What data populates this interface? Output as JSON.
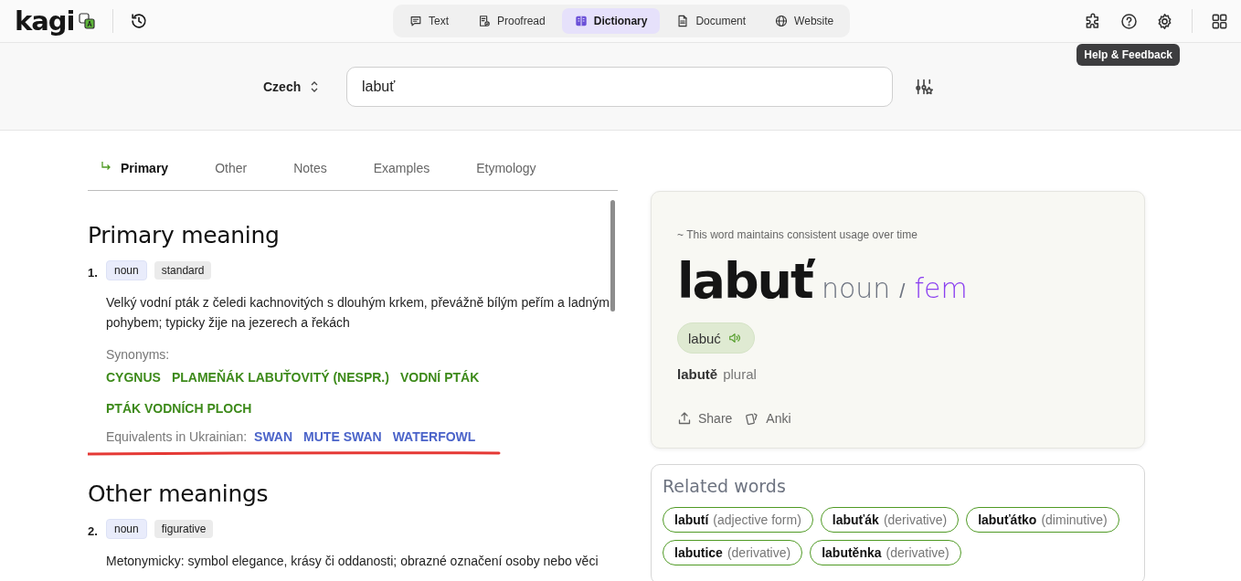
{
  "header": {
    "logo": "kagi",
    "modes": [
      {
        "label": "Text",
        "kind": "chat",
        "selected": false
      },
      {
        "label": "Proofread",
        "kind": "proof",
        "selected": false
      },
      {
        "label": "Dictionary",
        "kind": "book",
        "selected": true
      },
      {
        "label": "Document",
        "kind": "doc",
        "selected": false
      },
      {
        "label": "Website",
        "kind": "globe",
        "selected": false
      }
    ],
    "tooltip": "Help & Feedback"
  },
  "search": {
    "language": "Czech",
    "value": "labuť"
  },
  "tabs": [
    {
      "label": "Primary",
      "selected": true
    },
    {
      "label": "Other",
      "selected": false
    },
    {
      "label": "Notes",
      "selected": false
    },
    {
      "label": "Examples",
      "selected": false
    },
    {
      "label": "Etymology",
      "selected": false
    }
  ],
  "sections": [
    {
      "heading": "Primary meaning",
      "meanings": [
        {
          "number": "1.",
          "tags": [
            {
              "label": "noun",
              "kind": "pos"
            },
            {
              "label": "standard",
              "kind": "register"
            }
          ],
          "definition": "Velký vodní pták z čeledi kachnovitých s dlouhým krkem, převážně bílým peřím a ladným pohybem; typicky žije na jezerech a řekách",
          "synonyms_label": "Synonyms:",
          "synonyms": [
            "CYGNUS",
            "PLAMEŇÁK LABUŤOVITÝ (NESPR.)",
            "VODNÍ PTÁK",
            "PTÁK VODNÍCH PLOCH"
          ],
          "equivalents_label": "Equivalents in Ukrainian:",
          "equivalents": [
            "SWAN",
            "MUTE SWAN",
            "WATERFOWL"
          ]
        }
      ]
    },
    {
      "heading": "Other meanings",
      "meanings": [
        {
          "number": "2.",
          "tags": [
            {
              "label": "noun",
              "kind": "pos"
            },
            {
              "label": "figurative",
              "kind": "register"
            }
          ],
          "definition": "Metonymicky: symbol elegance, krásy či oddanosti; obrazné označení osoby nebo věci"
        }
      ]
    }
  ],
  "word": {
    "usage_note": "~ This word maintains consistent usage over time",
    "headword": "labuť",
    "pos": "noun",
    "separator": "/",
    "gender": "fem",
    "pronunciation": "labuć",
    "plural_form": "labutě",
    "plural_label": "plural",
    "actions": [
      {
        "label": "Share",
        "kind": "share"
      },
      {
        "label": "Anki",
        "kind": "cards"
      }
    ]
  },
  "related": {
    "title": "Related words",
    "items": [
      {
        "word": "labutí",
        "note": "(adjective form)"
      },
      {
        "word": "labuťák",
        "note": "(derivative)"
      },
      {
        "word": "labuťátko",
        "note": "(diminutive)"
      },
      {
        "word": "labutice",
        "note": "(derivative)"
      },
      {
        "word": "labutěnka",
        "note": "(derivative)"
      }
    ]
  }
}
